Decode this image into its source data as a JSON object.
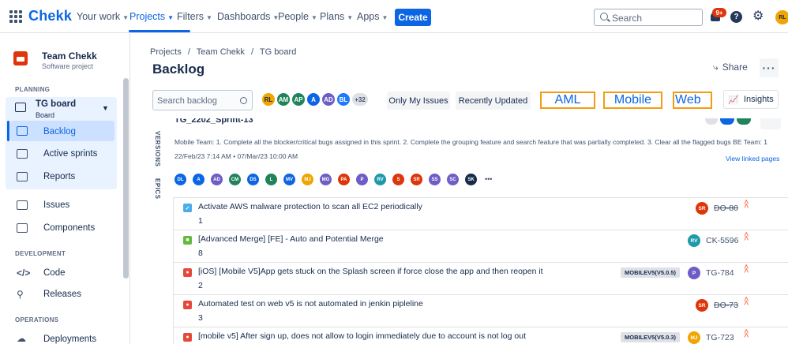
{
  "topnav": {
    "logo": "Chekk",
    "items": [
      {
        "label": "Your work",
        "active": false
      },
      {
        "label": "Projects",
        "active": true
      },
      {
        "label": "Filters",
        "active": false
      },
      {
        "label": "Dashboards",
        "active": false
      },
      {
        "label": "People",
        "active": false
      },
      {
        "label": "Plans",
        "active": false
      },
      {
        "label": "Apps",
        "active": false
      }
    ],
    "create_label": "Create",
    "search_placeholder": "Search",
    "notification_count": "9+",
    "user_initials": "RL"
  },
  "sidebar": {
    "project_name": "Team Chekk",
    "project_type": "Software project",
    "planning_title": "PLANNING",
    "board_title": "TG board",
    "board_sub": "Board",
    "planning_items": [
      "Backlog",
      "Active sprints",
      "Reports"
    ],
    "other_items": [
      "Issues",
      "Components"
    ],
    "development_title": "DEVELOPMENT",
    "development_items": [
      "Code",
      "Releases"
    ],
    "operations_title": "OPERATIONS",
    "operations_items": [
      "Deployments"
    ]
  },
  "main": {
    "breadcrumbs": [
      "Projects",
      "Team Chekk",
      "TG board"
    ],
    "title": "Backlog",
    "share_label": "Share",
    "search_placeholder": "Search backlog",
    "avatars": [
      {
        "initials": "RL",
        "color": "#f0a500"
      },
      {
        "initials": "AM",
        "color": "#1f845a"
      },
      {
        "initials": "AP",
        "color": "#1f845a"
      },
      {
        "initials": "A",
        "color": "#0c66e4"
      },
      {
        "initials": "AD",
        "color": "#6e5dc6"
      },
      {
        "initials": "BL",
        "color": "#1d7afc"
      }
    ],
    "avatar_more": "+32",
    "filters": [
      "Only My Issues",
      "Recently Updated"
    ],
    "highlights": [
      "AML",
      "Mobile",
      "Web"
    ],
    "insights_label": "Insights",
    "side_labels": [
      "VERSIONS",
      "EPICS"
    ],
    "sprint_name": "TG_2202_Sprint-13",
    "sprint_goal": "Mobile Team: 1. Complete all the blocker/critical bugs assigned in this sprint. 2. Complete the grouping feature and search feature that was partially completed. 3. Clear all the flagged bugs BE Team: 1",
    "sprint_dates": "22/Feb/23 7:14 AM • 07/Mar/23 10:00 AM",
    "view_linked": "View linked pages",
    "member_avatars": [
      {
        "initials": "DL",
        "color": "#0c66e4"
      },
      {
        "initials": "A",
        "color": "#0c66e4"
      },
      {
        "initials": "AD",
        "color": "#6e5dc6"
      },
      {
        "initials": "CM",
        "color": "#1f845a"
      },
      {
        "initials": "DS",
        "color": "#0c66e4"
      },
      {
        "initials": "L",
        "color": "#1f845a"
      },
      {
        "initials": "MV",
        "color": "#0c66e4"
      },
      {
        "initials": "MJ",
        "color": "#f0a500"
      },
      {
        "initials": "MG",
        "color": "#6e5dc6"
      },
      {
        "initials": "PA",
        "color": "#de350b"
      },
      {
        "initials": "P",
        "color": "#6e5dc6"
      },
      {
        "initials": "RV",
        "color": "#1d9aaa"
      },
      {
        "initials": "S",
        "color": "#de350b"
      },
      {
        "initials": "SR",
        "color": "#de350b"
      },
      {
        "initials": "SS",
        "color": "#6e5dc6"
      },
      {
        "initials": "SC",
        "color": "#6e5dc6"
      },
      {
        "initials": "SK",
        "color": "#172b4d"
      }
    ],
    "issues": [
      {
        "type": "task",
        "type_color": "#4bade8",
        "summary": "Activate AWS malware protection to scan all EC2 periodically",
        "points": "1",
        "epic": "",
        "assignee": "SR",
        "assignee_color": "#de350b",
        "key": "DO-80",
        "done": true
      },
      {
        "type": "story",
        "type_color": "#63ba3c",
        "summary": "[Advanced Merge] [FE] - Auto and Potential Merge",
        "points": "8",
        "epic": "",
        "assignee": "RV",
        "assignee_color": "#1d9aaa",
        "key": "CK-5596",
        "done": false
      },
      {
        "type": "bug",
        "type_color": "#e5493a",
        "summary": "[iOS] [Mobile V5]App gets stuck on the Splash screen if force close the app and then reopen it",
        "points": "2",
        "epic": "MOBILEV5(V5.0.5)",
        "assignee": "P",
        "assignee_color": "#6e5dc6",
        "key": "TG-784",
        "done": false
      },
      {
        "type": "bug",
        "type_color": "#e5493a",
        "summary": "Automated test on web v5 is not automated in jenkin pipleline",
        "points": "3",
        "epic": "",
        "assignee": "SR",
        "assignee_color": "#de350b",
        "key": "DO-73",
        "done": true
      },
      {
        "type": "bug",
        "type_color": "#e5493a",
        "summary": "[mobile v5] After sign up, does not allow to login immediately due to account is not log out",
        "points": "",
        "epic": "MOBILEV5(V5.0.3)",
        "assignee": "MJ",
        "assignee_color": "#f0a500",
        "key": "TG-723",
        "done": false
      }
    ]
  }
}
